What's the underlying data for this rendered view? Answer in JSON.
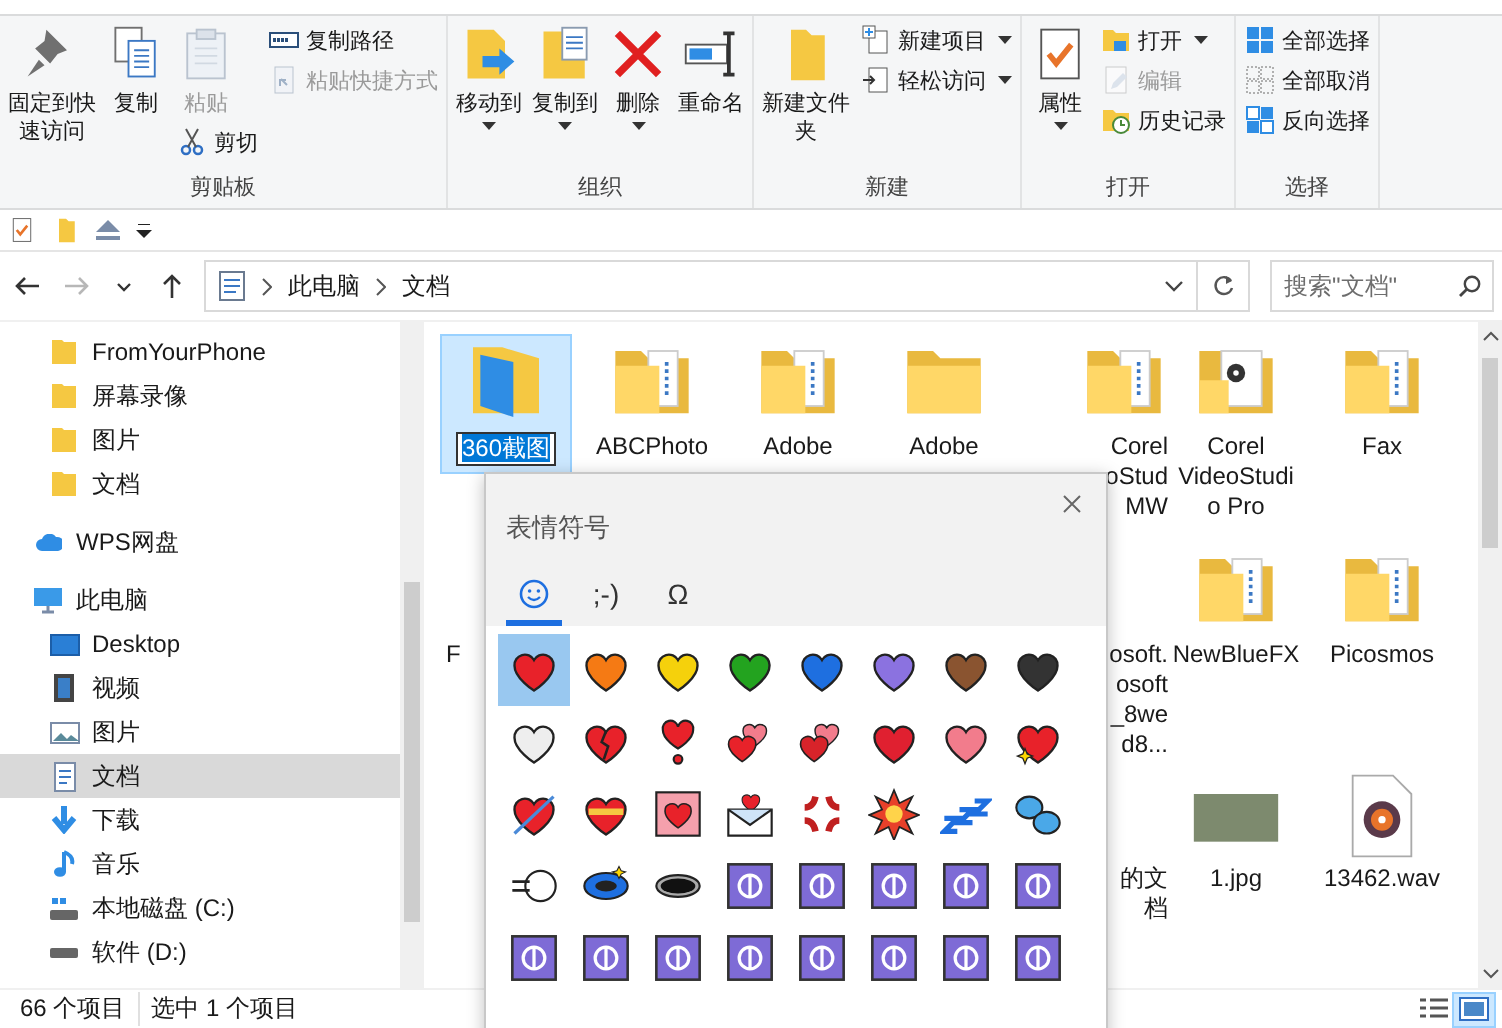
{
  "ribbon": {
    "groups": [
      {
        "label": "剪贴板",
        "items": [
          {
            "kind": "big",
            "label": "固定到快速访问",
            "disabled": false,
            "dropdown": false
          },
          {
            "kind": "big",
            "label": "复制",
            "disabled": false,
            "dropdown": false
          },
          {
            "kind": "column",
            "items": [
              {
                "kind": "big",
                "label": "粘贴",
                "disabled": true,
                "dropdown": false
              },
              {
                "kind": "small",
                "label": "剪切",
                "disabled": false,
                "dropdown": false
              }
            ]
          },
          {
            "kind": "column",
            "items": [
              {
                "kind": "small",
                "label": "复制路径",
                "disabled": false,
                "dropdown": false
              },
              {
                "kind": "small",
                "label": "粘贴快捷方式",
                "disabled": true,
                "dropdown": false
              }
            ]
          }
        ]
      },
      {
        "label": "组织",
        "items": [
          {
            "kind": "big",
            "label": "移动到",
            "disabled": false,
            "dropdown": true
          },
          {
            "kind": "big",
            "label": "复制到",
            "disabled": false,
            "dropdown": true
          },
          {
            "kind": "big",
            "label": "删除",
            "disabled": false,
            "dropdown": true
          },
          {
            "kind": "big",
            "label": "重命名",
            "disabled": false,
            "dropdown": false
          }
        ]
      },
      {
        "label": "新建",
        "items": [
          {
            "kind": "big",
            "label": "新建文件夹",
            "disabled": false,
            "dropdown": false
          },
          {
            "kind": "column",
            "items": [
              {
                "kind": "small",
                "label": "新建项目",
                "disabled": false,
                "dropdown": true
              },
              {
                "kind": "small",
                "label": "轻松访问",
                "disabled": false,
                "dropdown": true
              }
            ]
          }
        ]
      },
      {
        "label": "打开",
        "items": [
          {
            "kind": "big",
            "label": "属性",
            "disabled": false,
            "dropdown": true
          },
          {
            "kind": "column",
            "items": [
              {
                "kind": "small",
                "label": "打开",
                "disabled": false,
                "dropdown": true
              },
              {
                "kind": "small",
                "label": "编辑",
                "disabled": true,
                "dropdown": false
              },
              {
                "kind": "small",
                "label": "历史记录",
                "disabled": false,
                "dropdown": false
              }
            ]
          }
        ]
      },
      {
        "label": "选择",
        "items": [
          {
            "kind": "column",
            "items": [
              {
                "kind": "small",
                "label": "全部选择",
                "disabled": false,
                "dropdown": false
              },
              {
                "kind": "small",
                "label": "全部取消",
                "disabled": false,
                "dropdown": false
              },
              {
                "kind": "small",
                "label": "反向选择",
                "disabled": false,
                "dropdown": false
              }
            ]
          }
        ]
      }
    ]
  },
  "nav_buttons": [
    {
      "kind": "back",
      "disabled": false
    },
    {
      "kind": "forward",
      "disabled": true
    },
    {
      "kind": "recent",
      "disabled": false
    },
    {
      "kind": "up",
      "disabled": false
    }
  ],
  "address": {
    "path": [
      "此电脑",
      "文档"
    ]
  },
  "search": {
    "placeholder": "搜索\"文档\""
  },
  "sidebar": {
    "pinned": [
      {
        "kind": "folder",
        "label": "FromYourPhone",
        "selected": false
      },
      {
        "kind": "folder",
        "label": "屏幕录像",
        "selected": false
      },
      {
        "kind": "folder",
        "label": "图片",
        "selected": false
      },
      {
        "kind": "folder",
        "label": "文档",
        "selected": false
      }
    ],
    "items": [
      {
        "kind": "cloud",
        "label": "WPS网盘",
        "selected": false
      },
      {
        "kind": "pc",
        "label": "此电脑",
        "selected": false,
        "children": [
          {
            "kind": "desktop",
            "label": "Desktop",
            "selected": false
          },
          {
            "kind": "video",
            "label": "视频",
            "selected": false
          },
          {
            "kind": "pictures",
            "label": "图片",
            "selected": false
          },
          {
            "kind": "documents",
            "label": "文档",
            "selected": true
          },
          {
            "kind": "download",
            "label": "下载",
            "selected": false
          },
          {
            "kind": "music",
            "label": "音乐",
            "selected": false
          },
          {
            "kind": "drive-c",
            "label": "本地磁盘 (C:)",
            "selected": false
          },
          {
            "kind": "drive",
            "label": "软件 (D:)",
            "selected": false
          }
        ]
      }
    ]
  },
  "files": {
    "rows": [
      [
        {
          "kind": "folder-blue",
          "label": "360截图",
          "selected": true,
          "renaming": true
        },
        {
          "kind": "folder-docs",
          "label": "ABCPhoto",
          "selected": false,
          "renaming": false
        },
        {
          "kind": "folder-docs",
          "label": "Adobe",
          "selected": false,
          "renaming": false
        },
        {
          "kind": "folder",
          "label": "Adobe",
          "selected": false,
          "renaming": false
        },
        {
          "kind": "folder-docs",
          "lines": [
            "Corel",
            "oStud",
            "MW"
          ]
        },
        {
          "kind": "folder-media",
          "label": "Corel VideoStudio Pro",
          "selected": false,
          "renaming": false
        },
        {
          "kind": "folder-docs",
          "label": "Fax",
          "selected": false,
          "renaming": false
        }
      ],
      [
        {
          "lines": [
            "F"
          ]
        },
        "",
        "",
        "",
        {
          "lines": [
            "osoft.",
            "osoft",
            "_8we",
            "d8..."
          ]
        },
        {
          "kind": "folder-docs",
          "label": "NewBlueFX",
          "selected": false,
          "renaming": false
        },
        {
          "kind": "folder-docs",
          "label": "Picosmos",
          "selected": false,
          "renaming": false
        }
      ],
      [
        "",
        "",
        "",
        "",
        {
          "lines": [
            "的文",
            "档"
          ]
        },
        {
          "kind": "photo",
          "label": "1.jpg",
          "selected": false,
          "renaming": false
        },
        {
          "kind": "audio",
          "label": "13462.wav",
          "selected": false,
          "renaming": false
        }
      ]
    ]
  },
  "emoji_panel": {
    "title": "表情符号",
    "tabs": [
      {
        "kind": "emoji",
        "selected": true
      },
      {
        "kind": "text",
        "label": ";-)",
        "selected": false
      },
      {
        "kind": "text",
        "label": "Ω",
        "selected": false
      }
    ],
    "items": [
      {
        "kind": "heart",
        "color": "#e8222a",
        "selected": true
      },
      {
        "kind": "heart",
        "color": "#f57a14",
        "selected": false
      },
      {
        "kind": "heart",
        "color": "#f5d10c",
        "selected": false
      },
      {
        "kind": "heart",
        "color": "#23a31f",
        "selected": false
      },
      {
        "kind": "heart",
        "color": "#1e6fe0",
        "selected": false
      },
      {
        "kind": "heart",
        "color": "#8b72e0",
        "selected": false
      },
      {
        "kind": "heart",
        "color": "#8a5430",
        "selected": false
      },
      {
        "kind": "heart",
        "color": "#333333",
        "selected": false
      },
      {
        "kind": "heart",
        "color": "#eeeeee",
        "selected": false
      },
      {
        "kind": "broken-heart",
        "color": "#e8222a",
        "selected": false
      },
      {
        "kind": "heart-exclamation",
        "color": "#e8222a",
        "selected": false
      },
      {
        "kind": "two-hearts",
        "color": "#e8222a",
        "selected": false
      },
      {
        "kind": "two-hearts",
        "color": "#d8232a",
        "selected": false
      },
      {
        "kind": "heart",
        "color": "#e02030",
        "selected": false
      },
      {
        "kind": "heart",
        "color": "#f27c8c",
        "selected": false
      },
      {
        "kind": "heart-sparkle",
        "color": "#e8222a",
        "selected": false
      },
      {
        "kind": "heart-arrow",
        "color": "#e8222a",
        "selected": false
      },
      {
        "kind": "heart-ribbon",
        "color": "#e8222a",
        "selected": false
      },
      {
        "kind": "heart-tile",
        "color": "#f5a0ac",
        "selected": false
      },
      {
        "kind": "envelope",
        "selected": false
      },
      {
        "kind": "anger",
        "selected": false
      },
      {
        "kind": "burst",
        "selected": false
      },
      {
        "kind": "zzz",
        "selected": false
      },
      {
        "kind": "droplets",
        "selected": false
      },
      {
        "kind": "puff",
        "selected": false
      },
      {
        "kind": "dizzy",
        "selected": false
      },
      {
        "kind": "hole",
        "selected": false
      },
      {
        "kind": "symbol",
        "selected": false
      },
      {
        "kind": "symbol",
        "selected": false
      },
      {
        "kind": "symbol",
        "selected": false
      },
      {
        "kind": "symbol",
        "selected": false
      },
      {
        "kind": "symbol",
        "selected": false
      },
      {
        "kind": "symbol",
        "selected": false
      },
      {
        "kind": "symbol",
        "selected": false
      },
      {
        "kind": "symbol",
        "selected": false
      },
      {
        "kind": "symbol",
        "selected": false
      },
      {
        "kind": "symbol",
        "selected": false
      },
      {
        "kind": "symbol",
        "selected": false
      },
      {
        "kind": "symbol",
        "selected": false
      },
      {
        "kind": "symbol",
        "selected": false
      }
    ]
  },
  "status_bar": {
    "count": "66 个项目",
    "selection": "选中 1 个项目",
    "views": [
      {
        "kind": "details",
        "selected": false
      },
      {
        "kind": "large-icons",
        "selected": true
      }
    ]
  }
}
